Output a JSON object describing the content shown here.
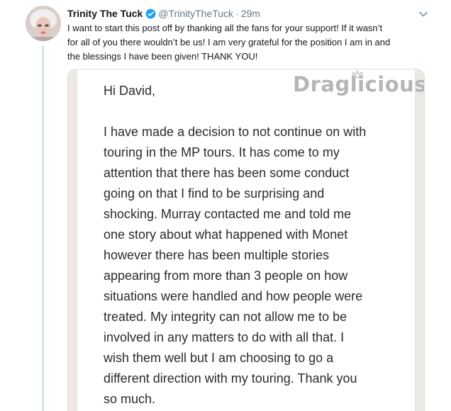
{
  "tweet": {
    "display_name": "Trinity The Tuck",
    "handle": "@TrinityTheTuck",
    "separator": "·",
    "time": "29m",
    "text": "I want to start this post off by thanking all the fans for your support! If it wasn't for all of you there wouldn't be us! I am very grateful for the position I am in and the blessings I have been given! THANK YOU!",
    "text_lines": [
      "I want to start this post off by thanking all the fans for your support! If it wasn’t",
      "for all of you there wouldn’t be us! I am very grateful for the position I am in and",
      "the blessings I have been given! THANK YOU!"
    ]
  },
  "icons": {
    "verified": "verified-badge-icon",
    "more": "chevron-down-icon",
    "crown": "crown-icon"
  },
  "colors": {
    "verified_blue": "#1da1f2",
    "thread_line": "#cfe6f7",
    "secondary_text": "#657786",
    "primary_text": "#14171a"
  },
  "note": {
    "greeting": "Hi David,",
    "watermark": "Draglicious",
    "body_lines": [
      "I have made a decision to not continue on with",
      "touring in the MP tours. It has come to my",
      "attention that there has been some conduct",
      "going on that I find to be surprising and",
      "shocking. Murray contacted me and told me",
      "one story about what happened with Monet",
      "however there has been multiple stories",
      "appearing from more than 3 people on how",
      "situations were handled and how people were",
      "treated. My integrity can not allow me to be",
      "involved in any matters to do with all that. I",
      "wish them well but I am choosing to go a",
      "different direction with my touring. Thank you",
      "so much."
    ]
  }
}
